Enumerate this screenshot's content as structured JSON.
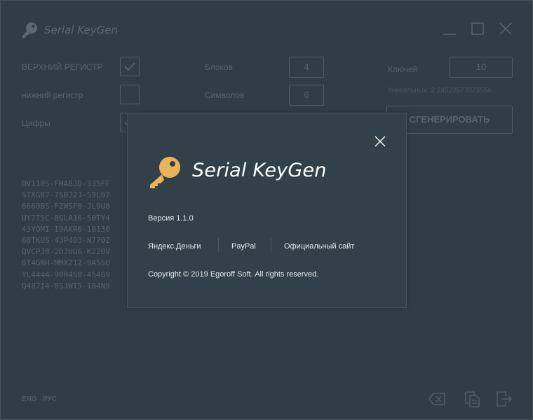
{
  "window": {
    "title": "Serial KeyGen",
    "accent_color": "#e8b45a"
  },
  "options": {
    "uppercase_label": "ВЕРХНИЙ РЕГИСТР",
    "uppercase_checked": true,
    "lowercase_label": "нижний регистр",
    "lowercase_checked": false,
    "digits_label": "Цифры",
    "digits_checked": true,
    "blocks_label": "Блоков",
    "blocks_value": "4",
    "symbols_label": "Символов",
    "symbols_value": "6",
    "keys_label": "Ключей",
    "keys_value": "10",
    "unique_text": "Уникальных: 2.2452257707355e...",
    "generate_label": "СГЕНЕРИРОВАТЬ"
  },
  "keys": [
    "OV110S-FHABJD-335FF",
    "S7XG87-7SBJ2J-S9L07",
    "6660BS-F2WSF0-JL9U8",
    "UY7T5C-8GLA16-50TY4",
    "43YOMI-I9AKR6-18130",
    "60TKUS-43P4O3-N77OZ",
    "QVCPJ8-2DJUU6-K220V",
    "6T4GNH-MMX212-9A5SU",
    "YL4444-90R4S0-454G9",
    "Q487I4-8S3WT5-1B4N9"
  ],
  "footer": {
    "lang_eng": "ENG",
    "lang_rus": "РУС",
    "icons": [
      "clear-icon",
      "copy-icon",
      "export-icon"
    ]
  },
  "about": {
    "title": "Serial KeyGen",
    "version": "Версия 1.1.0",
    "links": [
      "Яндекс.Деньги",
      "PayPal",
      "Официальный сайт"
    ],
    "copyright": "Copyright © 2019 Egoroff Soft. All rights reserved."
  }
}
